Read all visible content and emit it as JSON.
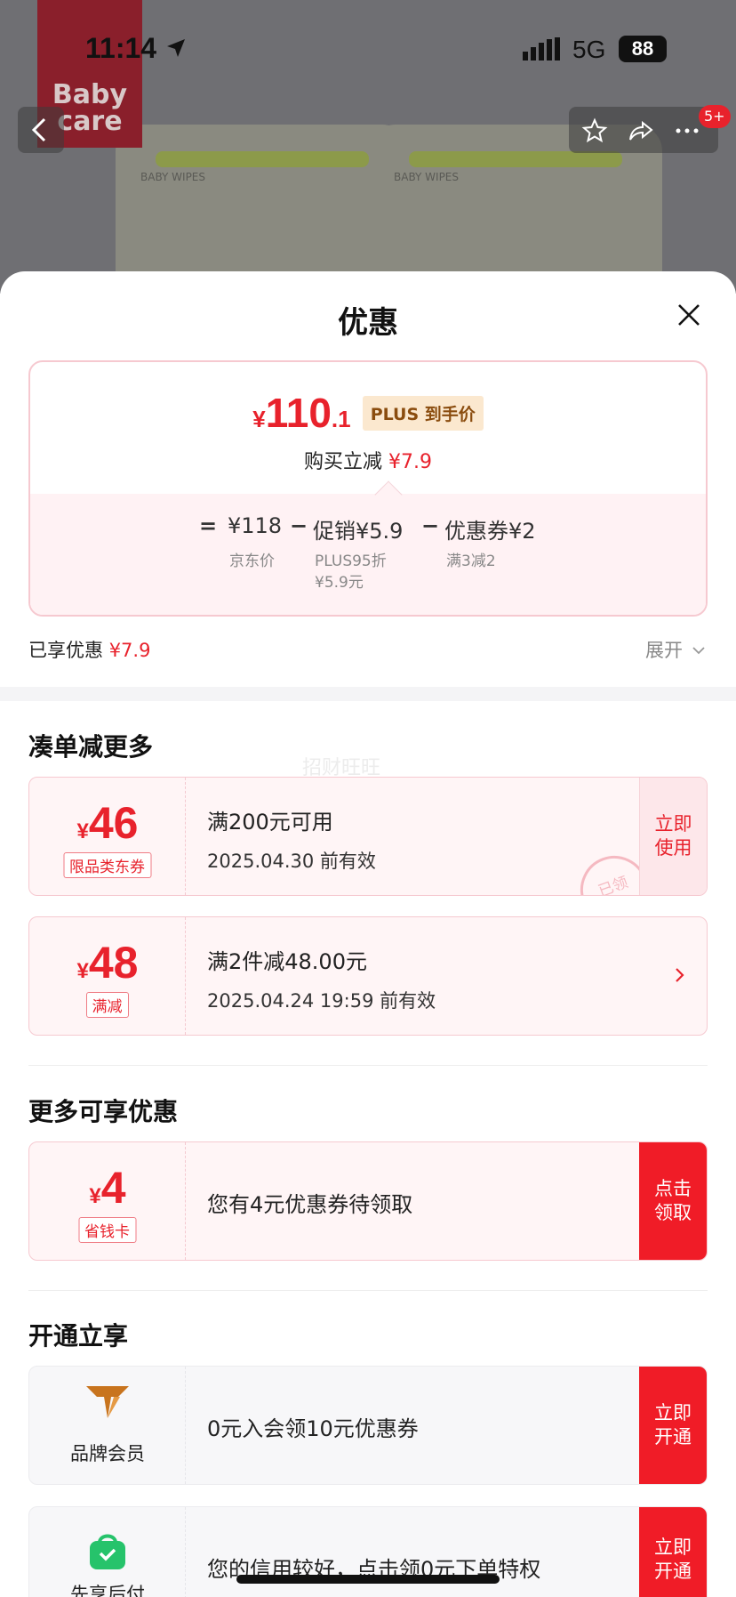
{
  "status_bar": {
    "time": "11:14",
    "network": "5G",
    "battery": "88"
  },
  "background": {
    "brand_line1": "Baby",
    "brand_line2": "care",
    "product_label": "BABY WIPES",
    "notification_badge": "5+"
  },
  "sheet": {
    "title": "优惠",
    "price_card": {
      "yen": "¥",
      "price_int": "110",
      "price_dec": ".1",
      "plus_tag": "PLUS 到手价",
      "reduce_label": "购买立减",
      "reduce_value": "¥7.9",
      "equals": "=",
      "jd_price": "¥118",
      "minus1": "−",
      "promo": "促销¥5.9",
      "minus2": "−",
      "coupon": "优惠券¥2",
      "jd_price_label": "京东价",
      "promo_label_line1": "PLUS95折",
      "promo_label_line2": "¥5.9元",
      "coupon_label": "满3减2"
    },
    "enjoyed_label": "已享优惠",
    "enjoyed_value": "¥7.9",
    "expand_label": "展开"
  },
  "watermark": "招财旺旺",
  "sections": {
    "more_discount_title": "凑单减更多",
    "more_benefits_title": "更多可享优惠",
    "open_title": "开通立享"
  },
  "coupons": [
    {
      "yen": "¥",
      "amount": "46",
      "tag": "限品类东券",
      "main": "满200元可用",
      "sub": "2025.04.30 前有效",
      "button": "立即使用",
      "stamp": "已领"
    },
    {
      "yen": "¥",
      "amount": "48",
      "tag": "满减",
      "main": "满2件减48.00元",
      "sub": "2025.04.24 19:59 前有效"
    }
  ],
  "benefit": {
    "yen": "¥",
    "amount": "4",
    "tag": "省钱卡",
    "main": "您有4元优惠券待领取",
    "button": "点击领取"
  },
  "open_items": [
    {
      "label": "品牌会员",
      "main": "0元入会领10元优惠券",
      "button": "立即开通"
    },
    {
      "label": "先享后付",
      "main": "您的信用较好，点击领0元下单特权",
      "button": "立即开通"
    }
  ],
  "colors": {
    "accent": "#e8222c",
    "pink_bg": "#fff5f6",
    "plus_tag_bg": "#fbe8cf",
    "brand_orange": "#c8741e",
    "green_bag": "#26c36b"
  }
}
